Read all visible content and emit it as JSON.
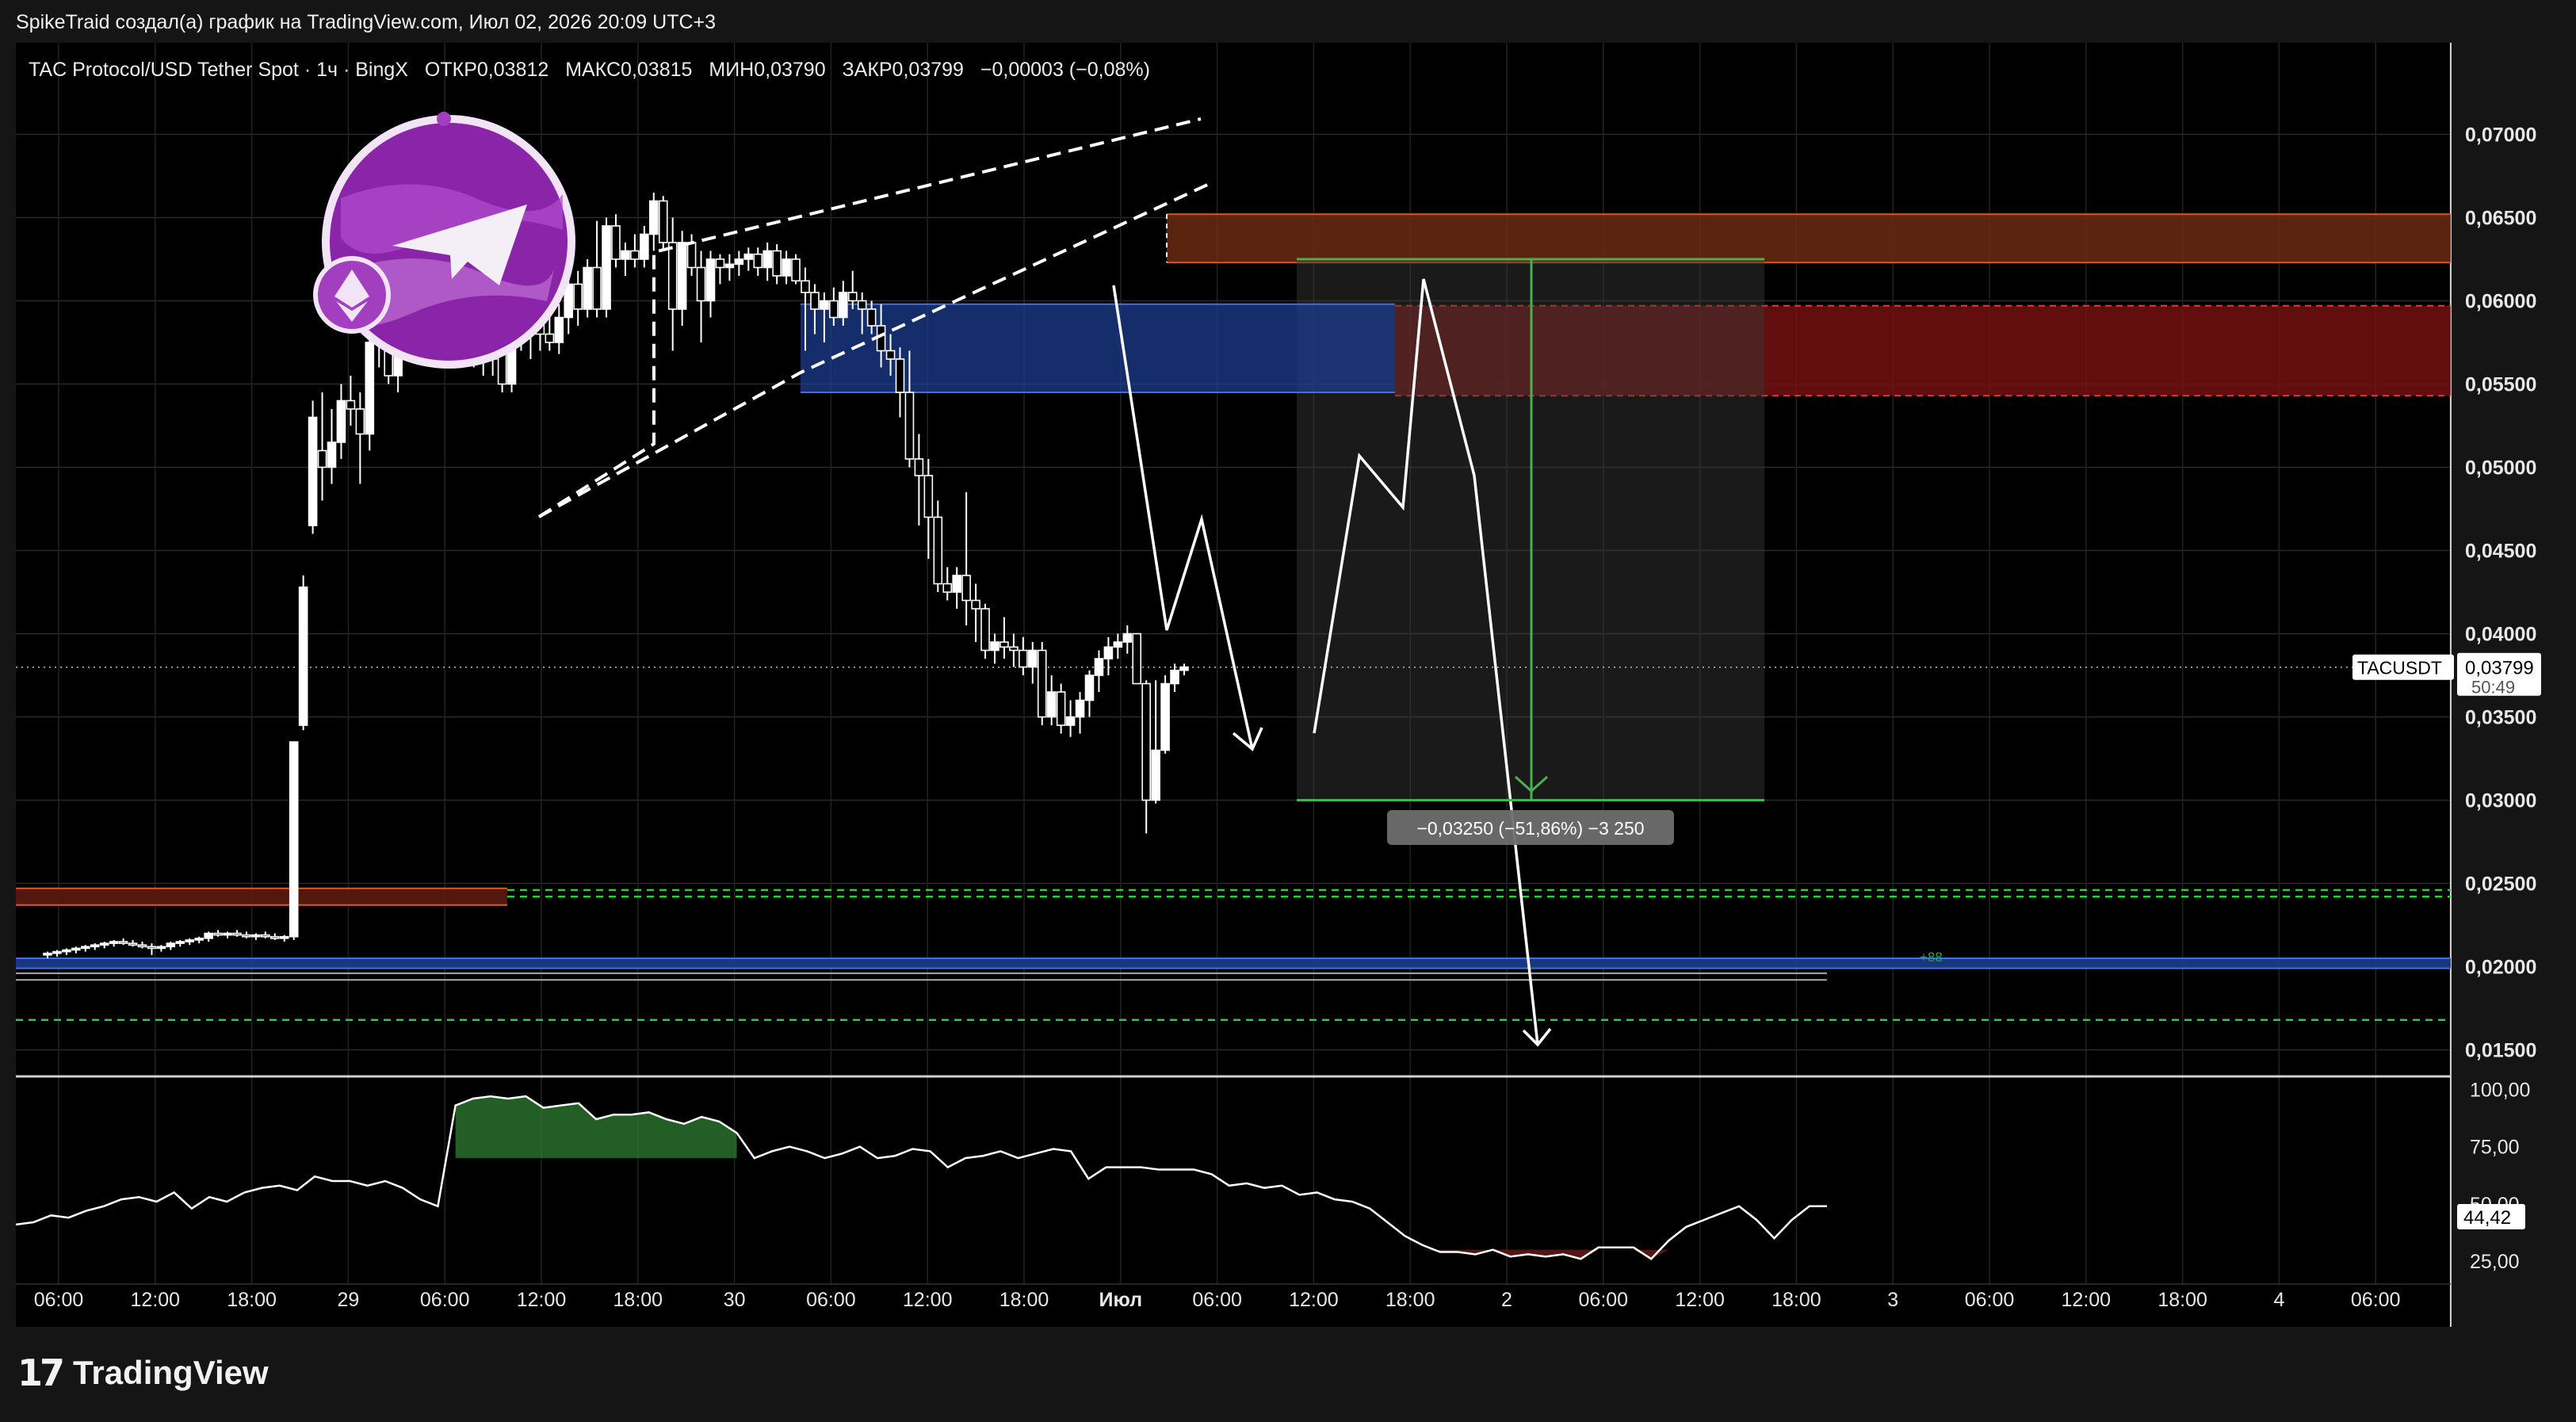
{
  "header": {
    "attribution": "SpikeTraid создал(а) график на TradingView.com, Июл 02, 2026 20:09 UTC+3"
  },
  "legend": {
    "symbol_name": "TAC Protocol/USD Tether Spot · 1ч · BingX",
    "open": "ОТКР0,03812",
    "high": "МАКС0,03815",
    "low": "МИН0,03790",
    "close": "ЗАКР0,03799",
    "change": "−0,00003 (−0,08%)"
  },
  "price_tag": {
    "ticker": "TACUSDT",
    "price": "0,03799",
    "countdown": "50:49"
  },
  "measure_label": "−0,03250 (−51,86%) −3 250",
  "zone_label": "+88",
  "oscillator_value": "44,42",
  "branding": {
    "logo_mark": "17",
    "name": "TradingView"
  },
  "colors": {
    "background": "#000000",
    "candle": "#ffffff",
    "supply_zone": "#7a1212",
    "order_block": "#1c3d8f",
    "measure_line": "#4caf50",
    "support_dashed": "#2ecc40",
    "osc_overbought": "#2e7d32",
    "osc_oversold": "#6b1a1a"
  },
  "chart_data": {
    "type": "candlestick",
    "timeframe": "1ч",
    "y_ticks": [
      "0,07000",
      "0,06500",
      "0,06000",
      "0,05500",
      "0,05000",
      "0,04500",
      "0,04000",
      "0,03500",
      "0,03000",
      "0,02500",
      "0,02000",
      "0,01500"
    ],
    "ylim": [
      0.0135,
      0.0755
    ],
    "x_ticks": [
      "06:00",
      "12:00",
      "18:00",
      "29",
      "06:00",
      "12:00",
      "18:00",
      "30",
      "06:00",
      "12:00",
      "18:00",
      "Июл",
      "06:00",
      "12:00",
      "18:00",
      "2",
      "06:00",
      "12:00",
      "18:00",
      "3",
      "06:00",
      "12:00",
      "18:00",
      "4",
      "06:00"
    ],
    "candles": [
      [
        0.0207,
        0.0209,
        0.0205,
        0.0208
      ],
      [
        0.0208,
        0.021,
        0.0206,
        0.0209
      ],
      [
        0.0209,
        0.0211,
        0.0207,
        0.021
      ],
      [
        0.021,
        0.0212,
        0.0208,
        0.0211
      ],
      [
        0.0211,
        0.0213,
        0.0209,
        0.0212
      ],
      [
        0.0212,
        0.0214,
        0.021,
        0.0213
      ],
      [
        0.0213,
        0.0215,
        0.0211,
        0.0214
      ],
      [
        0.0214,
        0.0216,
        0.0212,
        0.0215
      ],
      [
        0.0215,
        0.0217,
        0.0213,
        0.0214
      ],
      [
        0.0214,
        0.0216,
        0.0212,
        0.0213
      ],
      [
        0.0213,
        0.0215,
        0.0211,
        0.0212
      ],
      [
        0.0212,
        0.0214,
        0.0207,
        0.0211
      ],
      [
        0.0211,
        0.0213,
        0.0209,
        0.0212
      ],
      [
        0.0212,
        0.0215,
        0.021,
        0.0214
      ],
      [
        0.0214,
        0.0216,
        0.0212,
        0.0215
      ],
      [
        0.0215,
        0.0217,
        0.0213,
        0.0216
      ],
      [
        0.0216,
        0.0218,
        0.0214,
        0.0217
      ],
      [
        0.0217,
        0.0221,
        0.0215,
        0.022
      ],
      [
        0.022,
        0.0222,
        0.0218,
        0.0219
      ],
      [
        0.0219,
        0.0221,
        0.0217,
        0.022
      ],
      [
        0.022,
        0.0222,
        0.0218,
        0.0219
      ],
      [
        0.0219,
        0.0221,
        0.0217,
        0.0218
      ],
      [
        0.0218,
        0.022,
        0.0216,
        0.0219
      ],
      [
        0.0219,
        0.0221,
        0.0217,
        0.0218
      ],
      [
        0.0218,
        0.022,
        0.0216,
        0.0217
      ],
      [
        0.0217,
        0.0219,
        0.0215,
        0.0218
      ],
      [
        0.0218,
        0.0335,
        0.0216,
        0.0335
      ],
      [
        0.0345,
        0.0435,
        0.0342,
        0.0428
      ],
      [
        0.0465,
        0.054,
        0.046,
        0.053
      ],
      [
        0.051,
        0.0545,
        0.048,
        0.05
      ],
      [
        0.05,
        0.0535,
        0.049,
        0.0515
      ],
      [
        0.0515,
        0.055,
        0.0505,
        0.054
      ],
      [
        0.054,
        0.0555,
        0.0525,
        0.0535
      ],
      [
        0.0535,
        0.0545,
        0.049,
        0.052
      ],
      [
        0.052,
        0.059,
        0.051,
        0.0575
      ],
      [
        0.0575,
        0.0595,
        0.056,
        0.058
      ],
      [
        0.058,
        0.0598,
        0.055,
        0.0555
      ],
      [
        0.0555,
        0.058,
        0.0545,
        0.0575
      ],
      [
        0.0575,
        0.0602,
        0.0565,
        0.0595
      ],
      [
        0.0595,
        0.06,
        0.057,
        0.0585
      ],
      [
        0.0585,
        0.06,
        0.0575,
        0.0595
      ],
      [
        0.0595,
        0.06,
        0.058,
        0.059
      ],
      [
        0.059,
        0.06,
        0.058,
        0.0595
      ],
      [
        0.0595,
        0.061,
        0.0575,
        0.0585
      ],
      [
        0.0585,
        0.0605,
        0.057,
        0.0575
      ],
      [
        0.0575,
        0.0612,
        0.056,
        0.0605
      ],
      [
        0.0605,
        0.0608,
        0.0555,
        0.0565
      ],
      [
        0.0565,
        0.0605,
        0.0555,
        0.0595
      ],
      [
        0.0595,
        0.06,
        0.0545,
        0.055
      ],
      [
        0.055,
        0.0605,
        0.0545,
        0.059
      ],
      [
        0.059,
        0.06,
        0.057,
        0.058
      ],
      [
        0.058,
        0.06,
        0.0565,
        0.059
      ],
      [
        0.059,
        0.0598,
        0.057,
        0.058
      ],
      [
        0.058,
        0.0595,
        0.057,
        0.0575
      ],
      [
        0.0575,
        0.0598,
        0.0568,
        0.059
      ],
      [
        0.059,
        0.062,
        0.058,
        0.061
      ],
      [
        0.061,
        0.0618,
        0.0585,
        0.0595
      ],
      [
        0.0595,
        0.0625,
        0.059,
        0.062
      ],
      [
        0.062,
        0.0648,
        0.059,
        0.0595
      ],
      [
        0.0595,
        0.065,
        0.059,
        0.0645
      ],
      [
        0.0645,
        0.0652,
        0.062,
        0.0625
      ],
      [
        0.0625,
        0.0635,
        0.0615,
        0.063
      ],
      [
        0.063,
        0.064,
        0.062,
        0.0625
      ],
      [
        0.0625,
        0.0645,
        0.062,
        0.064
      ],
      [
        0.064,
        0.0665,
        0.063,
        0.066
      ],
      [
        0.066,
        0.0663,
        0.063,
        0.0635
      ],
      [
        0.0635,
        0.065,
        0.057,
        0.0595
      ],
      [
        0.0595,
        0.0642,
        0.0585,
        0.0635
      ],
      [
        0.0635,
        0.064,
        0.0615,
        0.062
      ],
      [
        0.062,
        0.063,
        0.0575,
        0.06
      ],
      [
        0.06,
        0.063,
        0.059,
        0.0625
      ],
      [
        0.0625,
        0.0628,
        0.061,
        0.062
      ],
      [
        0.062,
        0.0628,
        0.0612,
        0.0622
      ],
      [
        0.0622,
        0.063,
        0.0615,
        0.0625
      ],
      [
        0.0625,
        0.0632,
        0.0618,
        0.0628
      ],
      [
        0.0628,
        0.0632,
        0.0615,
        0.062
      ],
      [
        0.062,
        0.0635,
        0.0612,
        0.063
      ],
      [
        0.063,
        0.0634,
        0.061,
        0.0615
      ],
      [
        0.0615,
        0.063,
        0.061,
        0.0625
      ],
      [
        0.0625,
        0.0628,
        0.061,
        0.0612
      ],
      [
        0.0612,
        0.062,
        0.057,
        0.0605
      ],
      [
        0.0605,
        0.061,
        0.058,
        0.0595
      ],
      [
        0.0595,
        0.0605,
        0.0575,
        0.06
      ],
      [
        0.06,
        0.0608,
        0.0585,
        0.059
      ],
      [
        0.059,
        0.0612,
        0.0585,
        0.0605
      ],
      [
        0.0605,
        0.0618,
        0.0595,
        0.06
      ],
      [
        0.06,
        0.0605,
        0.058,
        0.0595
      ],
      [
        0.0595,
        0.06,
        0.058,
        0.0585
      ],
      [
        0.0585,
        0.0598,
        0.056,
        0.057
      ],
      [
        0.057,
        0.058,
        0.0555,
        0.0565
      ],
      [
        0.0565,
        0.0572,
        0.053,
        0.0545
      ],
      [
        0.0545,
        0.057,
        0.05,
        0.0505
      ],
      [
        0.0505,
        0.052,
        0.0465,
        0.0495
      ],
      [
        0.0495,
        0.0505,
        0.0445,
        0.047
      ],
      [
        0.047,
        0.048,
        0.0425,
        0.043
      ],
      [
        0.043,
        0.044,
        0.042,
        0.0425
      ],
      [
        0.0425,
        0.044,
        0.0415,
        0.0435
      ],
      [
        0.0435,
        0.0485,
        0.0405,
        0.042
      ],
      [
        0.042,
        0.043,
        0.0395,
        0.0415
      ],
      [
        0.0415,
        0.0418,
        0.0385,
        0.039
      ],
      [
        0.039,
        0.04,
        0.0382,
        0.0395
      ],
      [
        0.0395,
        0.041,
        0.0385,
        0.0392
      ],
      [
        0.0392,
        0.04,
        0.038,
        0.039
      ],
      [
        0.039,
        0.0398,
        0.0375,
        0.038
      ],
      [
        0.038,
        0.0395,
        0.037,
        0.039
      ],
      [
        0.039,
        0.0395,
        0.0345,
        0.035
      ],
      [
        0.035,
        0.0375,
        0.0345,
        0.0365
      ],
      [
        0.0365,
        0.037,
        0.034,
        0.0345
      ],
      [
        0.0345,
        0.036,
        0.0338,
        0.035
      ],
      [
        0.035,
        0.0365,
        0.034,
        0.036
      ],
      [
        0.036,
        0.0378,
        0.035,
        0.0375
      ],
      [
        0.0375,
        0.039,
        0.0365,
        0.0385
      ],
      [
        0.0385,
        0.0398,
        0.0375,
        0.0392
      ],
      [
        0.0392,
        0.04,
        0.0385,
        0.0395
      ],
      [
        0.0395,
        0.0405,
        0.0388,
        0.04
      ],
      [
        0.04,
        0.04,
        0.0375,
        0.037
      ],
      [
        0.037,
        0.0372,
        0.028,
        0.03
      ],
      [
        0.03,
        0.0372,
        0.0298,
        0.033
      ],
      [
        0.033,
        0.0375,
        0.0328,
        0.037
      ],
      [
        0.037,
        0.0382,
        0.0365,
        0.0378
      ],
      [
        0.0378,
        0.0382,
        0.0375,
        0.038
      ]
    ],
    "levels": [
      {
        "name": "supply-zone-upper",
        "from": 0.0623,
        "to": 0.0652
      },
      {
        "name": "supply-zone-lower",
        "from": 0.0543,
        "to": 0.0597
      },
      {
        "name": "order-block",
        "from": 0.0545,
        "to": 0.0598
      },
      {
        "name": "support-dashed-1",
        "value": 0.0246
      },
      {
        "name": "support-dashed-2",
        "value": 0.0242
      },
      {
        "name": "support-dashed-3",
        "value": 0.0168
      },
      {
        "name": "low-block",
        "from": 0.0199,
        "to": 0.0205
      },
      {
        "name": "low-red-zone",
        "from": 0.0237,
        "to": 0.0247
      }
    ],
    "measure": {
      "from": 0.0625,
      "to": 0.03
    },
    "oscillator": {
      "y_ticks": [
        "100,00",
        "75,00",
        "50,00",
        "25,00"
      ],
      "ylim": [
        15,
        105
      ],
      "values": [
        41,
        42,
        45,
        44,
        47,
        49,
        52,
        53,
        51,
        55,
        48,
        53,
        51,
        55,
        57,
        58,
        56,
        62,
        60,
        60,
        58,
        60,
        57,
        52,
        49,
        93,
        96,
        97,
        96,
        97,
        92,
        93,
        94,
        87,
        89,
        89,
        90,
        87,
        85,
        88,
        86,
        81,
        70,
        73,
        75,
        73,
        70,
        72,
        75,
        70,
        71,
        74,
        73,
        66,
        70,
        71,
        73,
        70,
        72,
        74,
        73,
        61,
        66,
        66,
        66,
        65,
        65,
        65,
        63,
        58,
        59,
        57,
        58,
        54,
        55,
        52,
        51,
        48,
        42,
        36,
        32,
        29,
        29,
        28,
        30,
        27,
        28,
        27,
        28,
        26,
        31,
        31,
        31,
        26,
        34,
        40,
        43,
        46,
        49,
        43,
        35,
        43,
        49,
        49
      ]
    }
  }
}
